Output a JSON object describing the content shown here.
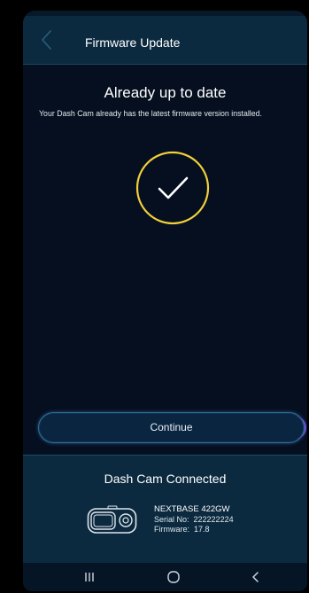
{
  "header": {
    "title": "Firmware Update",
    "back_icon": "chevron-left-icon"
  },
  "main": {
    "heading": "Already up to date",
    "message": "Your Dash Cam already has the latest firmware version installed.",
    "status_icon": "check-circle-icon",
    "continue_label": "Continue"
  },
  "footer": {
    "title": "Dash Cam Connected",
    "device": {
      "model": "NEXTBASE 422GW",
      "serial_label": "Serial No:",
      "serial_value": "222222224",
      "firmware_label": "Firmware:",
      "firmware_value": "17.8",
      "icon": "dash-cam-icon"
    }
  },
  "navbar": {
    "recents_icon": "recent-apps-icon",
    "home_icon": "home-icon",
    "back_icon": "back-icon"
  },
  "colors": {
    "background": "#050f1f",
    "panel": "#0c2a3f",
    "accent_yellow": "#f2cf3b",
    "button_border": "#2f6f94"
  }
}
